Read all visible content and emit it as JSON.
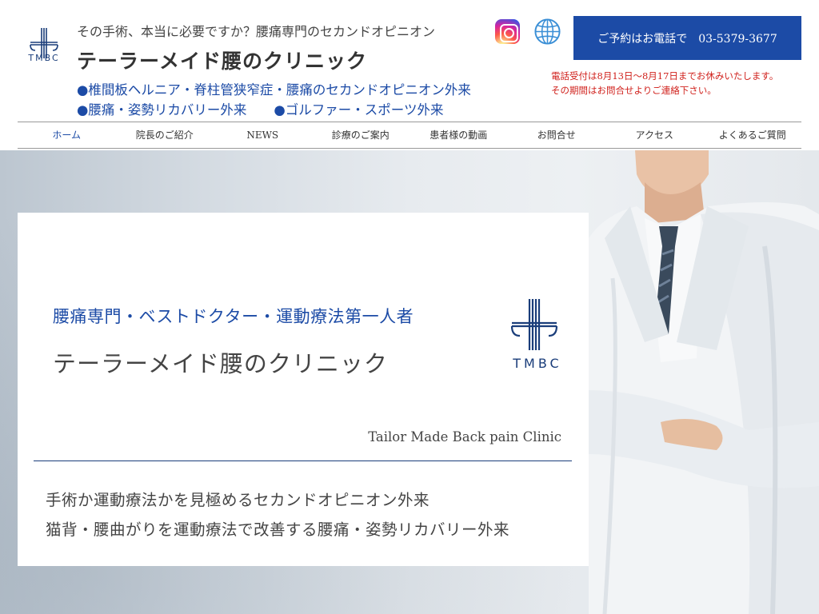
{
  "header": {
    "logo_text": "TMBC",
    "tagline": "その手術、本当に必要ですか？腰痛専門のセカンドオピニオン",
    "site_title": "テーラーメイド腰のクリニック",
    "dept_line1": "●椎間板ヘルニア・脊柱管狭窄症・腰痛のセカンドオピニオン外来",
    "dept_line2a": "●腰痛・姿勢リカバリー外来",
    "dept_line2b": "●ゴルファー・スポーツ外来",
    "call_button": "ご予約はお電話で　03-5379-3677",
    "notice_line1": "電話受付は8月13日～8月17日までお休みいたします。",
    "notice_line2": "その期間はお問合せよりご連絡下さい。"
  },
  "icons": {
    "instagram": "instagram-icon",
    "globe": "globe-icon"
  },
  "nav": {
    "items": [
      {
        "label": "ホーム"
      },
      {
        "label": "院長のご紹介"
      },
      {
        "label": "NEWS"
      },
      {
        "label": "診療のご案内"
      },
      {
        "label": "患者様の動画"
      },
      {
        "label": "お問合せ"
      },
      {
        "label": "アクセス"
      },
      {
        "label": "よくあるご質問"
      }
    ],
    "active_index": 0
  },
  "hero": {
    "subtitle": "腰痛専門・ベストドクター・運動療法第一人者",
    "title": "テーラーメイド腰のクリニック",
    "logo_text": "TMBC",
    "english_name": "Tailor Made Back pain Clinic",
    "line1": "手術か運動療法かを見極めるセカンドオピニオン外来",
    "line2": "猫背・腰曲がりを運動療法で改善する腰痛・姿勢リカバリー外来"
  },
  "colors": {
    "brand_blue": "#1c4ba6",
    "navy": "#1a3d7a",
    "notice_red": "#d0211c"
  }
}
